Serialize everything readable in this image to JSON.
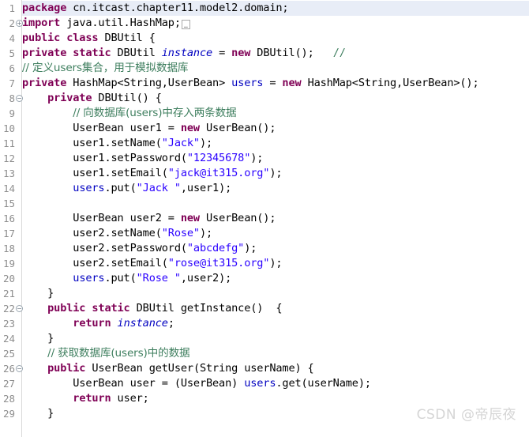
{
  "editor": {
    "language": "Java",
    "highlight_line": 1,
    "colors": {
      "background": "#ffffff",
      "gutter_text": "#8e8e8e",
      "keyword": "#7f0055",
      "string": "#2a00ff",
      "comment": "#3f7f5f",
      "field": "#0000c0",
      "plain": "#000000",
      "current_line_highlight": "#e8edf7",
      "watermark": "#d5d5d5"
    },
    "fold_collapsed_glyph": "…",
    "fold_expand_icon": "fold-expand-icon",
    "fold_collapse_icon": "fold-collapse-icon"
  },
  "watermark": {
    "text": "CSDN @帝辰夜"
  },
  "lines": [
    {
      "number": "1",
      "fold": "",
      "highlight": true,
      "tokens": [
        {
          "t": "kw",
          "v": "package"
        },
        {
          "t": "plain",
          "v": " cn.itcast.chapter11.model2.domain;"
        }
      ]
    },
    {
      "number": "2",
      "fold": "plus",
      "highlight": false,
      "tokens": [
        {
          "t": "kw",
          "v": "import"
        },
        {
          "t": "plain",
          "v": " java.util.HashMap;"
        },
        {
          "t": "foldbox",
          "v": ""
        }
      ]
    },
    {
      "number": "4",
      "fold": "",
      "highlight": false,
      "tokens": [
        {
          "t": "kw",
          "v": "public class"
        },
        {
          "t": "plain",
          "v": " DBUtil {"
        }
      ]
    },
    {
      "number": "5",
      "fold": "",
      "highlight": false,
      "tokens": [
        {
          "t": "kw",
          "v": "private static"
        },
        {
          "t": "plain",
          "v": " DBUtil "
        },
        {
          "t": "fld-i",
          "v": "instance"
        },
        {
          "t": "plain",
          "v": " = "
        },
        {
          "t": "kw",
          "v": "new"
        },
        {
          "t": "plain",
          "v": " DBUtil();   "
        },
        {
          "t": "cmt",
          "v": "//"
        }
      ]
    },
    {
      "number": "6",
      "fold": "",
      "highlight": false,
      "tokens": [
        {
          "t": "cmt",
          "v": "// 定义users集合，用于模拟数据库"
        }
      ]
    },
    {
      "number": "7",
      "fold": "",
      "highlight": false,
      "tokens": [
        {
          "t": "kw",
          "v": "private"
        },
        {
          "t": "plain",
          "v": " HashMap<String,UserBean> "
        },
        {
          "t": "fld",
          "v": "users"
        },
        {
          "t": "plain",
          "v": " = "
        },
        {
          "t": "kw",
          "v": "new"
        },
        {
          "t": "plain",
          "v": " HashMap<String,UserBean>();"
        }
      ]
    },
    {
      "number": "8",
      "fold": "minus",
      "highlight": false,
      "tokens": [
        {
          "t": "plain",
          "v": "    "
        },
        {
          "t": "kw",
          "v": "private"
        },
        {
          "t": "plain",
          "v": " DBUtil() {"
        }
      ]
    },
    {
      "number": "9",
      "fold": "",
      "highlight": false,
      "tokens": [
        {
          "t": "plain",
          "v": "        "
        },
        {
          "t": "cmt",
          "v": "// 向数据库(users)中存入两条数据"
        }
      ]
    },
    {
      "number": "10",
      "fold": "",
      "highlight": false,
      "tokens": [
        {
          "t": "plain",
          "v": "        UserBean user1 = "
        },
        {
          "t": "kw",
          "v": "new"
        },
        {
          "t": "plain",
          "v": " UserBean();"
        }
      ]
    },
    {
      "number": "11",
      "fold": "",
      "highlight": false,
      "tokens": [
        {
          "t": "plain",
          "v": "        user1.setName("
        },
        {
          "t": "str",
          "v": "\"Jack\""
        },
        {
          "t": "plain",
          "v": ");"
        }
      ]
    },
    {
      "number": "12",
      "fold": "",
      "highlight": false,
      "tokens": [
        {
          "t": "plain",
          "v": "        user1.setPassword("
        },
        {
          "t": "str",
          "v": "\"12345678\""
        },
        {
          "t": "plain",
          "v": ");"
        }
      ]
    },
    {
      "number": "13",
      "fold": "",
      "highlight": false,
      "tokens": [
        {
          "t": "plain",
          "v": "        user1.setEmail("
        },
        {
          "t": "str",
          "v": "\"jack@it315.org\""
        },
        {
          "t": "plain",
          "v": ");"
        }
      ]
    },
    {
      "number": "14",
      "fold": "",
      "highlight": false,
      "tokens": [
        {
          "t": "plain",
          "v": "        "
        },
        {
          "t": "fld",
          "v": "users"
        },
        {
          "t": "plain",
          "v": ".put("
        },
        {
          "t": "str",
          "v": "\"Jack \""
        },
        {
          "t": "plain",
          "v": ",user1);"
        }
      ]
    },
    {
      "number": "15",
      "fold": "",
      "highlight": false,
      "tokens": []
    },
    {
      "number": "16",
      "fold": "",
      "highlight": false,
      "tokens": [
        {
          "t": "plain",
          "v": "        UserBean user2 = "
        },
        {
          "t": "kw",
          "v": "new"
        },
        {
          "t": "plain",
          "v": " UserBean();"
        }
      ]
    },
    {
      "number": "17",
      "fold": "",
      "highlight": false,
      "tokens": [
        {
          "t": "plain",
          "v": "        user2.setName("
        },
        {
          "t": "str",
          "v": "\"Rose\""
        },
        {
          "t": "plain",
          "v": ");"
        }
      ]
    },
    {
      "number": "18",
      "fold": "",
      "highlight": false,
      "tokens": [
        {
          "t": "plain",
          "v": "        user2.setPassword("
        },
        {
          "t": "str",
          "v": "\"abcdefg\""
        },
        {
          "t": "plain",
          "v": ");"
        }
      ]
    },
    {
      "number": "19",
      "fold": "",
      "highlight": false,
      "tokens": [
        {
          "t": "plain",
          "v": "        user2.setEmail("
        },
        {
          "t": "str",
          "v": "\"rose@it315.org\""
        },
        {
          "t": "plain",
          "v": ");"
        }
      ]
    },
    {
      "number": "20",
      "fold": "",
      "highlight": false,
      "tokens": [
        {
          "t": "plain",
          "v": "        "
        },
        {
          "t": "fld",
          "v": "users"
        },
        {
          "t": "plain",
          "v": ".put("
        },
        {
          "t": "str",
          "v": "\"Rose \""
        },
        {
          "t": "plain",
          "v": ",user2);"
        }
      ]
    },
    {
      "number": "21",
      "fold": "",
      "highlight": false,
      "tokens": [
        {
          "t": "plain",
          "v": "    }"
        }
      ]
    },
    {
      "number": "22",
      "fold": "minus",
      "highlight": false,
      "tokens": [
        {
          "t": "plain",
          "v": "    "
        },
        {
          "t": "kw",
          "v": "public static"
        },
        {
          "t": "plain",
          "v": " DBUtil getInstance()  {"
        }
      ]
    },
    {
      "number": "23",
      "fold": "",
      "highlight": false,
      "tokens": [
        {
          "t": "plain",
          "v": "        "
        },
        {
          "t": "kw",
          "v": "return"
        },
        {
          "t": "plain",
          "v": " "
        },
        {
          "t": "fld-i",
          "v": "instance"
        },
        {
          "t": "plain",
          "v": ";"
        }
      ]
    },
    {
      "number": "24",
      "fold": "",
      "highlight": false,
      "tokens": [
        {
          "t": "plain",
          "v": "    }"
        }
      ]
    },
    {
      "number": "25",
      "fold": "",
      "highlight": false,
      "tokens": [
        {
          "t": "plain",
          "v": "    "
        },
        {
          "t": "cmt",
          "v": "// 获取数据库(users)中的数据"
        }
      ]
    },
    {
      "number": "26",
      "fold": "minus",
      "highlight": false,
      "tokens": [
        {
          "t": "plain",
          "v": "    "
        },
        {
          "t": "kw",
          "v": "public"
        },
        {
          "t": "plain",
          "v": " UserBean getUser(String userName) {"
        }
      ]
    },
    {
      "number": "27",
      "fold": "",
      "highlight": false,
      "tokens": [
        {
          "t": "plain",
          "v": "        UserBean user = (UserBean) "
        },
        {
          "t": "fld",
          "v": "users"
        },
        {
          "t": "plain",
          "v": ".get(userName);"
        }
      ]
    },
    {
      "number": "28",
      "fold": "",
      "highlight": false,
      "tokens": [
        {
          "t": "plain",
          "v": "        "
        },
        {
          "t": "kw",
          "v": "return"
        },
        {
          "t": "plain",
          "v": " user;"
        }
      ]
    },
    {
      "number": "29",
      "fold": "",
      "highlight": false,
      "tokens": [
        {
          "t": "plain",
          "v": "    }"
        }
      ]
    }
  ]
}
